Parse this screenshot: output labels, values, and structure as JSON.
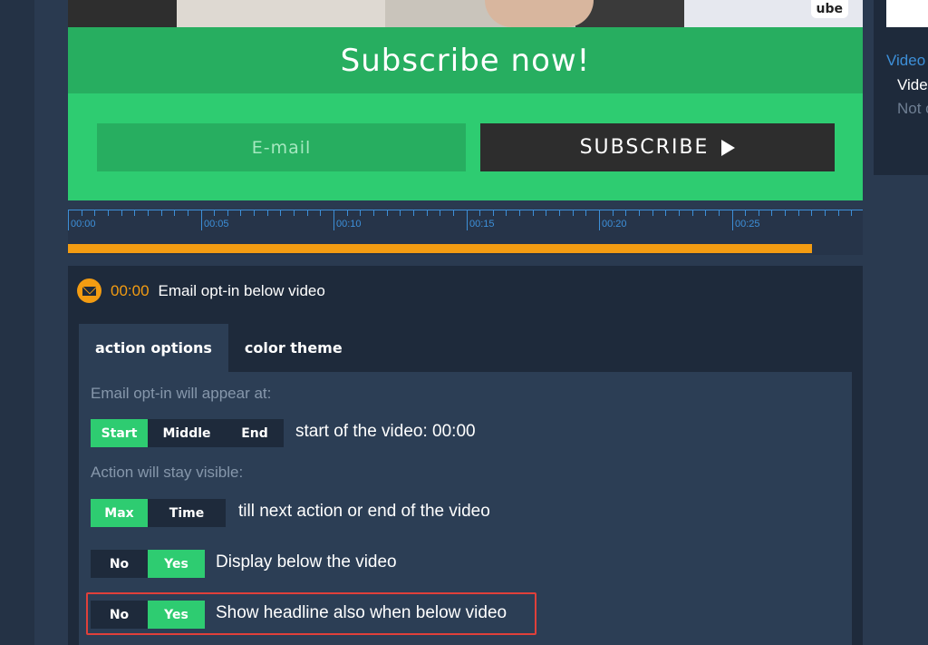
{
  "video_overlay": {
    "logo_text": "ube",
    "headline": "Subscribe now!",
    "email_placeholder": "E-mail",
    "subscribe_label": "SUBSCRIBE"
  },
  "timeline": {
    "labels": [
      "00:00",
      "00:05",
      "00:10",
      "00:15",
      "00:20",
      "00:25"
    ],
    "progress_fraction": 0.967
  },
  "action": {
    "time": "00:00",
    "title": "Email opt-in below video",
    "tabs": [
      "action options",
      "color theme"
    ],
    "active_tab": "action options",
    "appear_label": "Email opt-in will appear at:",
    "appear_options": [
      "Start",
      "Middle",
      "End"
    ],
    "appear_selected": "Start",
    "appear_text": "start of the video: 00:00",
    "visible_label": "Action will stay visible:",
    "visible_options": [
      "Max",
      "Time"
    ],
    "visible_selected": "Max",
    "visible_text": "till next action or end of the video",
    "display_below": {
      "no": "No",
      "yes": "Yes",
      "selected": "Yes",
      "text": "Display below the video"
    },
    "headline_below": {
      "no": "No",
      "yes": "Yes",
      "selected": "Yes",
      "text": "Show headline also when below video"
    }
  },
  "sidebar": {
    "link": "Video",
    "title": "Vide",
    "sub": "Not c"
  },
  "colors": {
    "accent_green": "#2ecc71",
    "dark_green": "#27ae60",
    "orange": "#f39c12",
    "blue": "#3d8fd8",
    "highlight_red": "#e0403a"
  }
}
